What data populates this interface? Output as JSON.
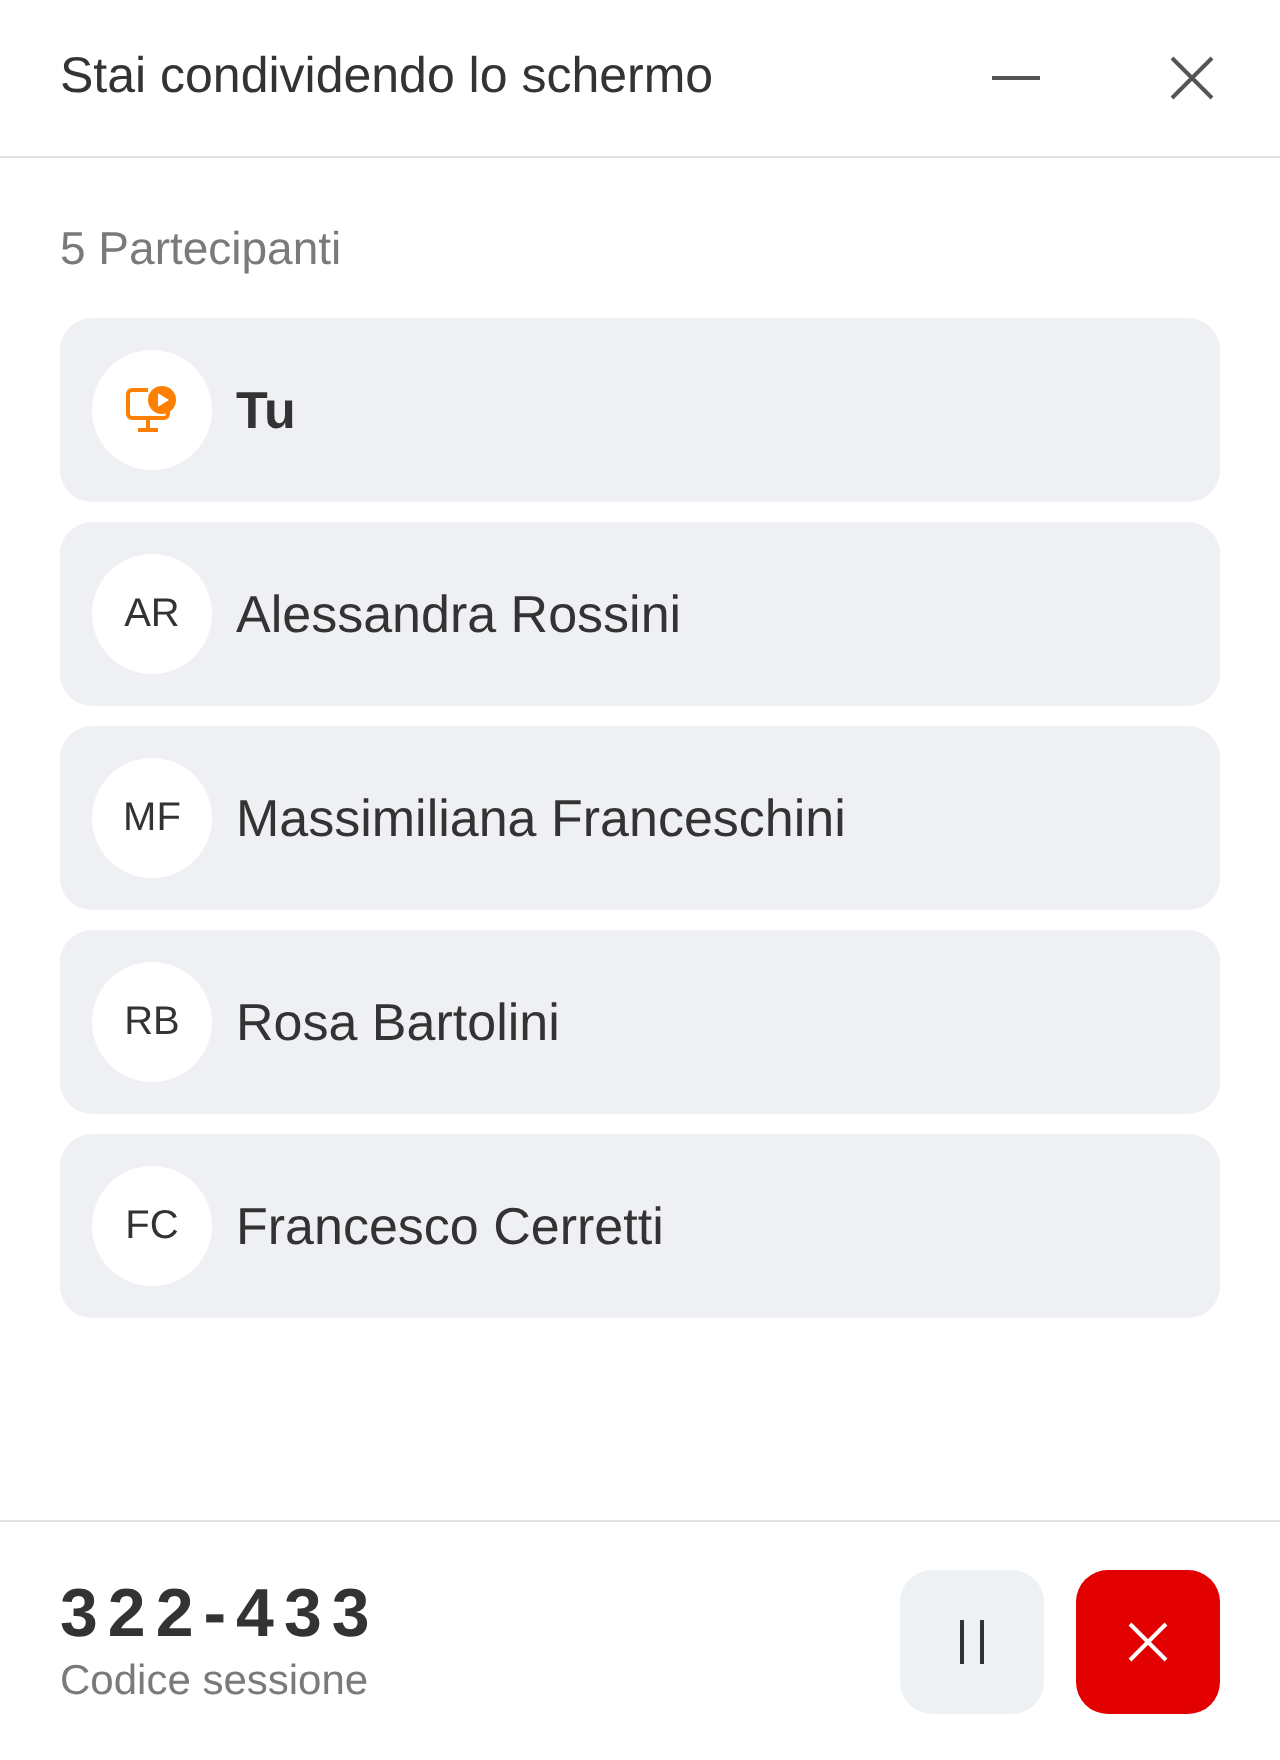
{
  "window": {
    "title": "Stai condividendo lo schermo"
  },
  "participants": {
    "count_label": "5 Partecipanti",
    "items": [
      {
        "kind": "self",
        "name": "Tu"
      },
      {
        "kind": "person",
        "initials": "AR",
        "name": "Alessandra Rossini"
      },
      {
        "kind": "person",
        "initials": "MF",
        "name": "Massimiliana Franceschini"
      },
      {
        "kind": "person",
        "initials": "RB",
        "name": "Rosa Bartolini"
      },
      {
        "kind": "person",
        "initials": "FC",
        "name": "Francesco Cerretti"
      }
    ]
  },
  "footer": {
    "session_code": "322-433",
    "session_label": "Codice sessione"
  }
}
